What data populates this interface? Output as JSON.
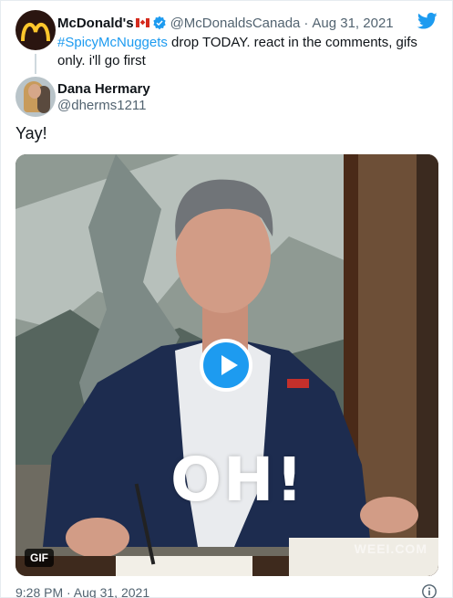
{
  "parent_tweet": {
    "display_name": "McDonald's",
    "handle": "@McDonaldsCanada",
    "separator": "·",
    "date": "Aug 31, 2021",
    "hashtag": "#SpicyMcNuggets",
    "text": " drop TODAY. react in the comments, gifs only. i'll go first",
    "flag_icon": "canada-flag-icon",
    "verified_icon": "verified-badge-icon"
  },
  "reply": {
    "display_name": "Dana Hermary",
    "handle": "@dherms1211",
    "text": "Yay!",
    "gif_caption": "OH!",
    "gif_badge": "GIF",
    "watermark": "WEEI.COM",
    "timestamp": "9:28 PM · Aug 31, 2021"
  },
  "icons": {
    "brand": "twitter-logo-icon",
    "info": "info-icon",
    "play": "play-icon"
  },
  "colors": {
    "accent": "#1d9bf0",
    "secondary_text": "#536471",
    "primary_text": "#0f1419",
    "mcdonalds_red": "#da291c",
    "mcdonalds_yellow": "#ffc72c"
  }
}
